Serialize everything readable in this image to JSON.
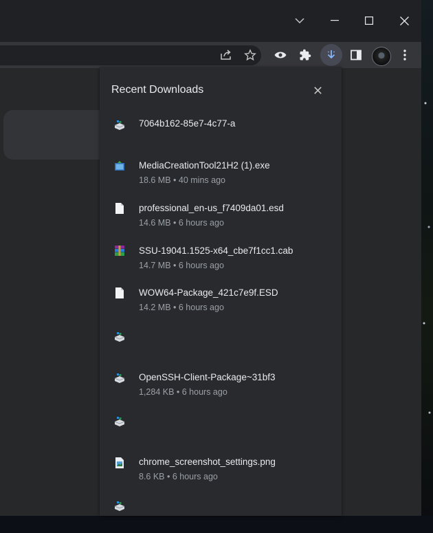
{
  "window": {
    "controls": [
      "tab-search",
      "minimize",
      "maximize",
      "close"
    ]
  },
  "toolbar": {
    "icons": [
      "share-icon",
      "star-icon",
      "eye-icon",
      "puzzle-icon",
      "download-icon",
      "sidepanel-icon",
      "avatar",
      "kebab-icon"
    ]
  },
  "downloads": {
    "title": "Recent Downloads",
    "items": [
      {
        "icon": "installer-icon",
        "name": "7064b162-85e7-4c77-a",
        "meta": ""
      },
      {
        "icon": "app-icon",
        "name": "MediaCreationTool21H2 (1).exe",
        "meta": "18.6 MB • 40 mins ago"
      },
      {
        "icon": "file-icon",
        "name": "professional_en-us_f7409da01.esd",
        "meta": "14.6 MB • 6 hours ago"
      },
      {
        "icon": "archive-icon",
        "name": "SSU-19041.1525-x64_cbe7f1cc1.cab",
        "meta": "14.7 MB • 6 hours ago"
      },
      {
        "icon": "file-icon",
        "name": "WOW64-Package_421c7e9f.ESD",
        "meta": "14.2 MB • 6 hours ago"
      },
      {
        "icon": "installer-icon",
        "name": "",
        "meta": ""
      },
      {
        "icon": "installer-icon",
        "name": "OpenSSH-Client-Package~31bf3",
        "meta": "1,284 KB • 6 hours ago"
      },
      {
        "icon": "installer-icon",
        "name": "",
        "meta": ""
      },
      {
        "icon": "image-file-icon",
        "name": "chrome_screenshot_settings.png",
        "meta": "8.6 KB • 6 hours ago"
      },
      {
        "icon": "installer-icon",
        "name": "",
        "meta": ""
      }
    ]
  }
}
